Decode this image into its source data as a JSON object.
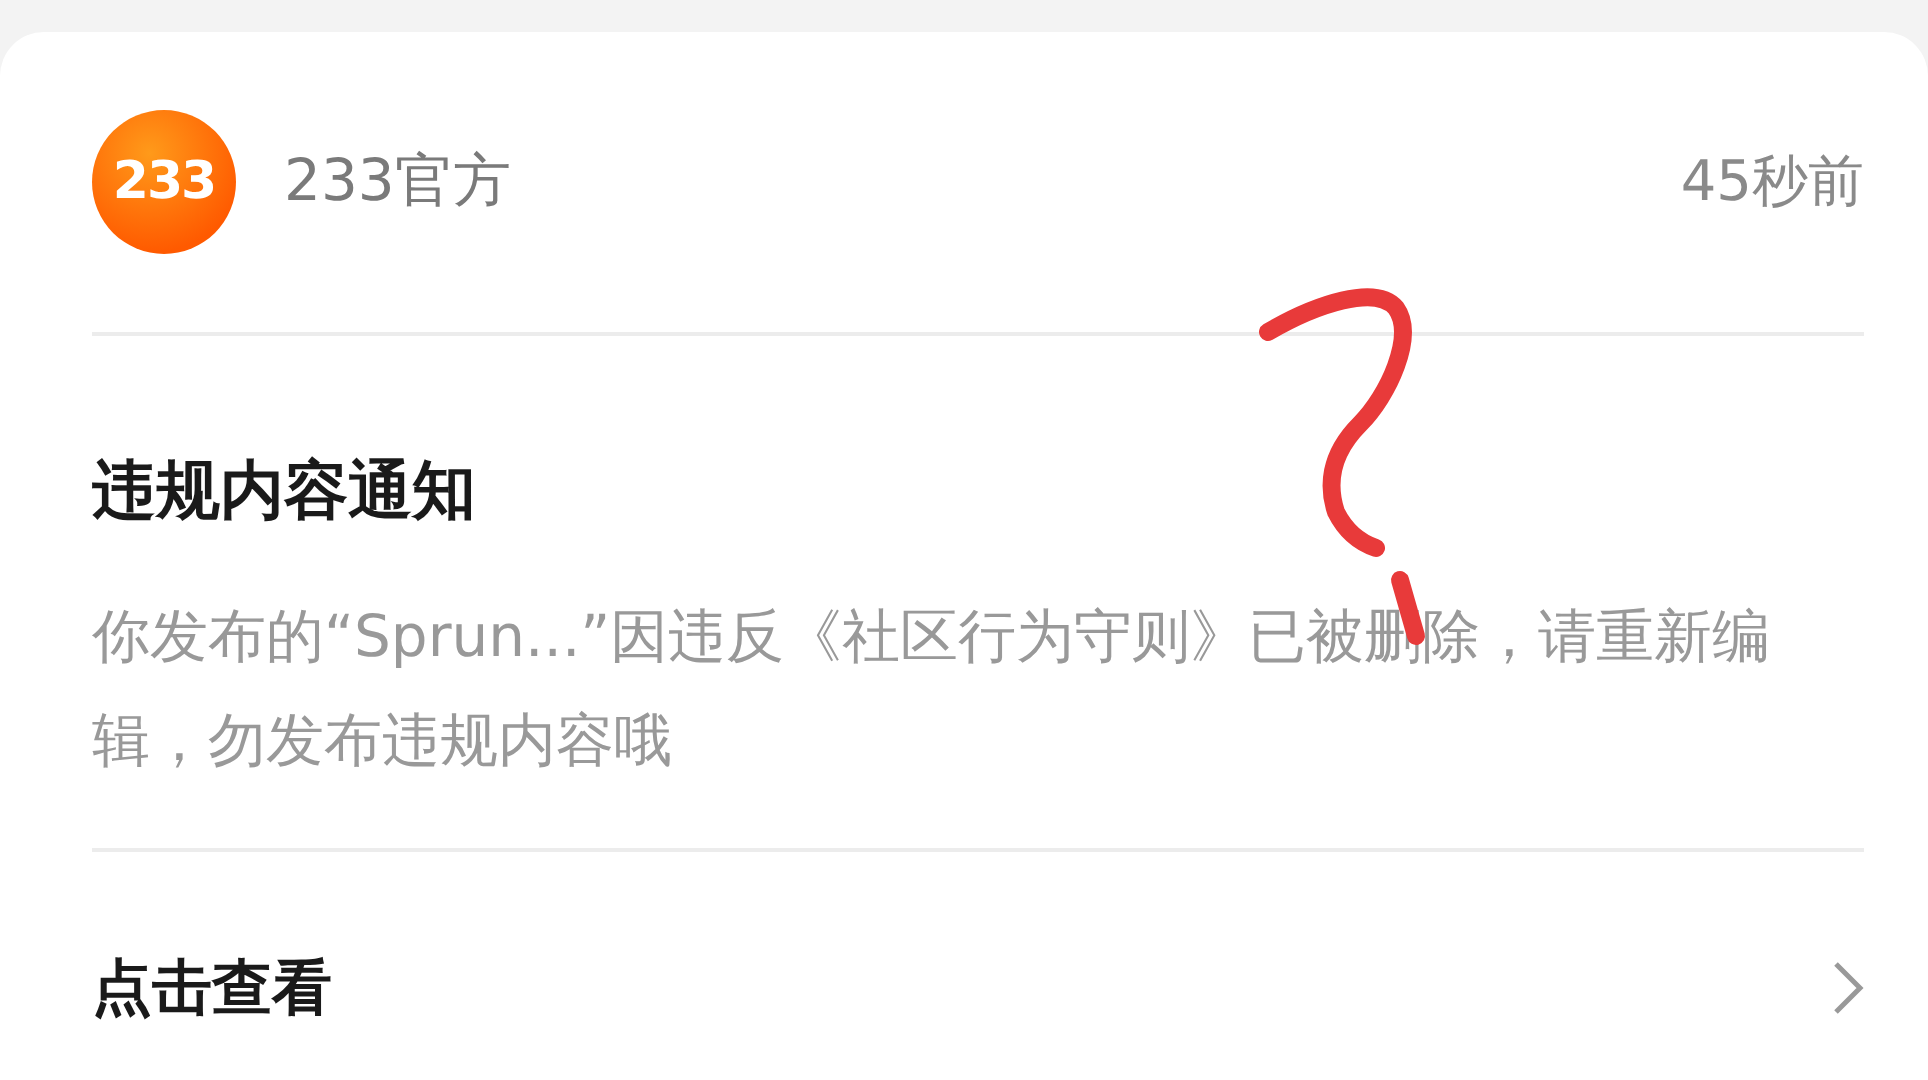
{
  "sender": {
    "logo_text": "233",
    "name": "233官方",
    "time": "45秒前"
  },
  "notice": {
    "title": "违规内容通知",
    "body": "你发布的“Sprun...”因违反《社区行为守则》已被删除，请重新编辑，勿发布违规内容哦"
  },
  "action": {
    "label": "点击查看"
  }
}
